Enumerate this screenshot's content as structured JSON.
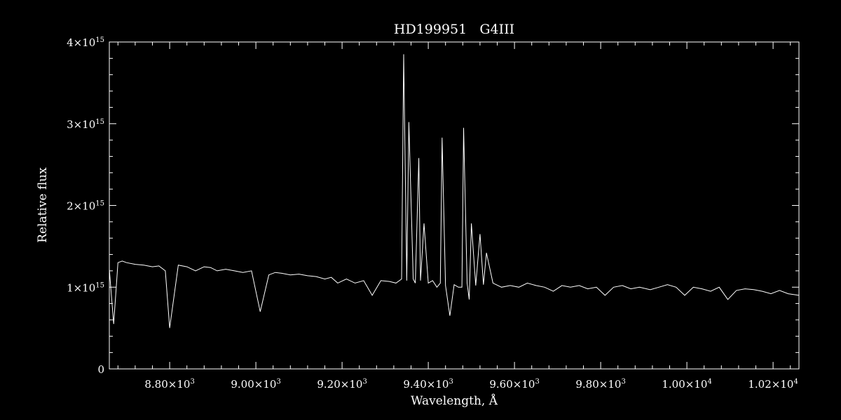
{
  "chart_data": {
    "type": "line",
    "title": "HD199951   G4III",
    "xlabel": "Wavelength, Å",
    "ylabel": "Relative flux",
    "xlim": [
      8660,
      10260
    ],
    "ylim": [
      0,
      4000000000000000.0
    ],
    "grid": false,
    "legend": "none",
    "colors": {
      "background": "#000000",
      "foreground": "#ffffff"
    },
    "x_ticks": [
      {
        "value": 8800,
        "mantissa": "8.80",
        "exponent": "3"
      },
      {
        "value": 9000,
        "mantissa": "9.00",
        "exponent": "3"
      },
      {
        "value": 9200,
        "mantissa": "9.20",
        "exponent": "3"
      },
      {
        "value": 9400,
        "mantissa": "9.40",
        "exponent": "3"
      },
      {
        "value": 9600,
        "mantissa": "9.60",
        "exponent": "3"
      },
      {
        "value": 9800,
        "mantissa": "9.80",
        "exponent": "3"
      },
      {
        "value": 10000,
        "mantissa": "1.00",
        "exponent": "4"
      },
      {
        "value": 10200,
        "mantissa": "1.02",
        "exponent": "4"
      }
    ],
    "y_ticks": [
      {
        "value": 0,
        "mantissa": "0",
        "exponent": ""
      },
      {
        "value": 1000000000000000.0,
        "mantissa": "1",
        "exponent": "15"
      },
      {
        "value": 2000000000000000.0,
        "mantissa": "2",
        "exponent": "15"
      },
      {
        "value": 3000000000000000.0,
        "mantissa": "3",
        "exponent": "15"
      },
      {
        "value": 4000000000000000.0,
        "mantissa": "4",
        "exponent": "15"
      }
    ],
    "series": [
      {
        "x": [
          8660,
          8670,
          8680,
          8690,
          8700,
          8720,
          8740,
          8760,
          8775,
          8790,
          8800,
          8820,
          8840,
          8860,
          8880,
          8895,
          8910,
          8930,
          8950,
          8970,
          8990,
          9010,
          9030,
          9045,
          9060,
          9080,
          9100,
          9120,
          9140,
          9160,
          9175,
          9190,
          9210,
          9230,
          9250,
          9270,
          9290,
          9310,
          9325,
          9338,
          9343,
          9350,
          9355,
          9365,
          9370,
          9378,
          9382,
          9390,
          9400,
          9410,
          9420,
          9428,
          9432,
          9440,
          9450,
          9460,
          9470,
          9478,
          9482,
          9490,
          9495,
          9500,
          9510,
          9520,
          9528,
          9535,
          9550,
          9570,
          9590,
          9610,
          9630,
          9650,
          9670,
          9690,
          9710,
          9730,
          9750,
          9770,
          9790,
          9810,
          9830,
          9850,
          9870,
          9890,
          9915,
          9935,
          9955,
          9975,
          9995,
          10015,
          10035,
          10055,
          10075,
          10095,
          10115,
          10135,
          10155,
          10175,
          10195,
          10215,
          10235,
          10260
        ],
        "y": [
          1220000000000000.0,
          550000000000000.0,
          1300000000000000.0,
          1320000000000000.0,
          1300000000000000.0,
          1280000000000000.0,
          1270000000000000.0,
          1250000000000000.0,
          1260000000000000.0,
          1200000000000000.0,
          500000000000000.0,
          1270000000000000.0,
          1250000000000000.0,
          1200000000000000.0,
          1250000000000000.0,
          1240000000000000.0,
          1200000000000000.0,
          1220000000000000.0,
          1200000000000000.0,
          1180000000000000.0,
          1200000000000000.0,
          700000000000000.0,
          1150000000000000.0,
          1180000000000000.0,
          1170000000000000.0,
          1150000000000000.0,
          1160000000000000.0,
          1140000000000000.0,
          1130000000000000.0,
          1100000000000000.0,
          1120000000000000.0,
          1050000000000000.0,
          1100000000000000.0,
          1050000000000000.0,
          1080000000000000.0,
          900000000000000.0,
          1080000000000000.0,
          1070000000000000.0,
          1050000000000000.0,
          1100000000000000.0,
          3850000000000000.0,
          1080000000000000.0,
          3020000000000000.0,
          1100000000000000.0,
          1050000000000000.0,
          2580000000000000.0,
          1080000000000000.0,
          1780000000000000.0,
          1050000000000000.0,
          1080000000000000.0,
          1000000000000000.0,
          1050000000000000.0,
          2830000000000000.0,
          1020000000000000.0,
          650000000000000.0,
          1030000000000000.0,
          1000000000000000.0,
          1000000000000000.0,
          2950000000000000.0,
          1050000000000000.0,
          850000000000000.0,
          1780000000000000.0,
          1020000000000000.0,
          1650000000000000.0,
          1030000000000000.0,
          1420000000000000.0,
          1050000000000000.0,
          1000000000000000.0,
          1020000000000000.0,
          1000000000000000.0,
          1050000000000000.0,
          1020000000000000.0,
          1000000000000000.0,
          950000000000000.0,
          1020000000000000.0,
          1000000000000000.0,
          1020000000000000.0,
          980000000000000.0,
          1000000000000000.0,
          900000000000000.0,
          1000000000000000.0,
          1020000000000000.0,
          980000000000000.0,
          1000000000000000.0,
          970000000000000.0,
          1000000000000000.0,
          1030000000000000.0,
          1000000000000000.0,
          900000000000000.0,
          1000000000000000.0,
          980000000000000.0,
          950000000000000.0,
          1000000000000000.0,
          850000000000000.0,
          960000000000000.0,
          980000000000000.0,
          970000000000000.0,
          950000000000000.0,
          920000000000000.0,
          960000000000000.0,
          920000000000000.0,
          900000000000000.0
        ]
      }
    ]
  }
}
